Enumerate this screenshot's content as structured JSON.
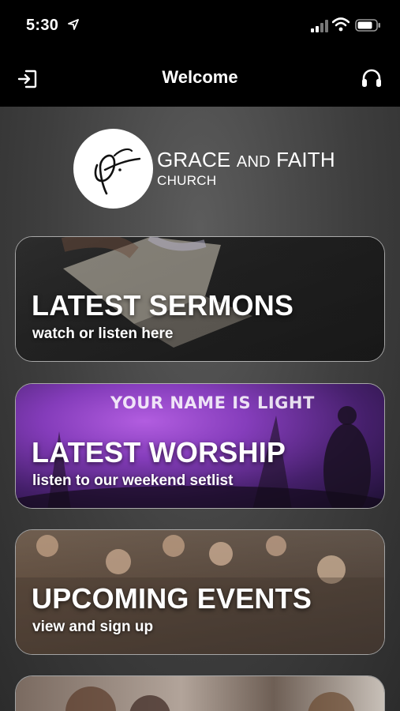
{
  "status_bar": {
    "time": "5:30",
    "icons": [
      "location-arrow-icon",
      "signal-icon",
      "wifi-icon",
      "battery-icon"
    ]
  },
  "nav": {
    "title": "Welcome",
    "left_icon": "exit-icon",
    "right_icon": "headphones-icon"
  },
  "logo": {
    "line1_a": "GRACE",
    "line1_b": "AND",
    "line1_c": "FAITH",
    "line2": "CHURCH"
  },
  "cards": [
    {
      "title": "LATEST SERMONS",
      "subtitle": "watch or listen here"
    },
    {
      "title": "LATEST WORSHIP",
      "subtitle": "listen to our weekend setlist",
      "image_text": "YOUR NAME IS LIGHT"
    },
    {
      "title": "UPCOMING EVENTS",
      "subtitle": "view and sign up"
    },
    {
      "title": "",
      "subtitle": ""
    }
  ],
  "colors": {
    "bar_background": "#000000",
    "content_background": "#4a4a4a",
    "text": "#ffffff",
    "worship_accent": "#b25de0"
  }
}
